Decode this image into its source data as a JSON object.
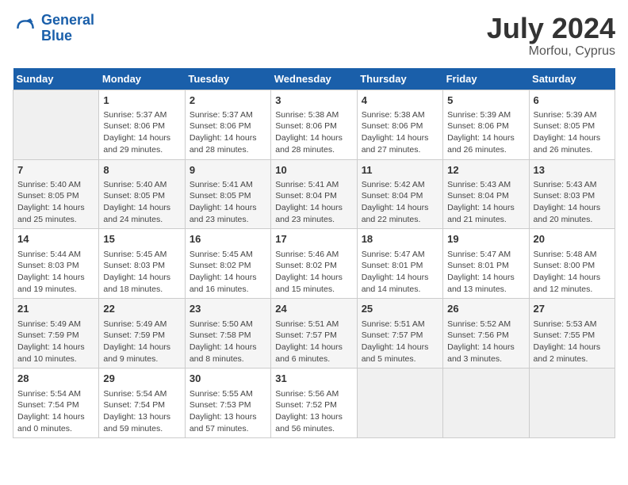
{
  "header": {
    "logo_line1": "General",
    "logo_line2": "Blue",
    "month_year": "July 2024",
    "location": "Morfou, Cyprus"
  },
  "weekdays": [
    "Sunday",
    "Monday",
    "Tuesday",
    "Wednesday",
    "Thursday",
    "Friday",
    "Saturday"
  ],
  "weeks": [
    [
      {
        "day": "",
        "content": ""
      },
      {
        "day": "1",
        "content": "Sunrise: 5:37 AM\nSunset: 8:06 PM\nDaylight: 14 hours\nand 29 minutes."
      },
      {
        "day": "2",
        "content": "Sunrise: 5:37 AM\nSunset: 8:06 PM\nDaylight: 14 hours\nand 28 minutes."
      },
      {
        "day": "3",
        "content": "Sunrise: 5:38 AM\nSunset: 8:06 PM\nDaylight: 14 hours\nand 28 minutes."
      },
      {
        "day": "4",
        "content": "Sunrise: 5:38 AM\nSunset: 8:06 PM\nDaylight: 14 hours\nand 27 minutes."
      },
      {
        "day": "5",
        "content": "Sunrise: 5:39 AM\nSunset: 8:06 PM\nDaylight: 14 hours\nand 26 minutes."
      },
      {
        "day": "6",
        "content": "Sunrise: 5:39 AM\nSunset: 8:05 PM\nDaylight: 14 hours\nand 26 minutes."
      }
    ],
    [
      {
        "day": "7",
        "content": "Sunrise: 5:40 AM\nSunset: 8:05 PM\nDaylight: 14 hours\nand 25 minutes."
      },
      {
        "day": "8",
        "content": "Sunrise: 5:40 AM\nSunset: 8:05 PM\nDaylight: 14 hours\nand 24 minutes."
      },
      {
        "day": "9",
        "content": "Sunrise: 5:41 AM\nSunset: 8:05 PM\nDaylight: 14 hours\nand 23 minutes."
      },
      {
        "day": "10",
        "content": "Sunrise: 5:41 AM\nSunset: 8:04 PM\nDaylight: 14 hours\nand 23 minutes."
      },
      {
        "day": "11",
        "content": "Sunrise: 5:42 AM\nSunset: 8:04 PM\nDaylight: 14 hours\nand 22 minutes."
      },
      {
        "day": "12",
        "content": "Sunrise: 5:43 AM\nSunset: 8:04 PM\nDaylight: 14 hours\nand 21 minutes."
      },
      {
        "day": "13",
        "content": "Sunrise: 5:43 AM\nSunset: 8:03 PM\nDaylight: 14 hours\nand 20 minutes."
      }
    ],
    [
      {
        "day": "14",
        "content": "Sunrise: 5:44 AM\nSunset: 8:03 PM\nDaylight: 14 hours\nand 19 minutes."
      },
      {
        "day": "15",
        "content": "Sunrise: 5:45 AM\nSunset: 8:03 PM\nDaylight: 14 hours\nand 18 minutes."
      },
      {
        "day": "16",
        "content": "Sunrise: 5:45 AM\nSunset: 8:02 PM\nDaylight: 14 hours\nand 16 minutes."
      },
      {
        "day": "17",
        "content": "Sunrise: 5:46 AM\nSunset: 8:02 PM\nDaylight: 14 hours\nand 15 minutes."
      },
      {
        "day": "18",
        "content": "Sunrise: 5:47 AM\nSunset: 8:01 PM\nDaylight: 14 hours\nand 14 minutes."
      },
      {
        "day": "19",
        "content": "Sunrise: 5:47 AM\nSunset: 8:01 PM\nDaylight: 14 hours\nand 13 minutes."
      },
      {
        "day": "20",
        "content": "Sunrise: 5:48 AM\nSunset: 8:00 PM\nDaylight: 14 hours\nand 12 minutes."
      }
    ],
    [
      {
        "day": "21",
        "content": "Sunrise: 5:49 AM\nSunset: 7:59 PM\nDaylight: 14 hours\nand 10 minutes."
      },
      {
        "day": "22",
        "content": "Sunrise: 5:49 AM\nSunset: 7:59 PM\nDaylight: 14 hours\nand 9 minutes."
      },
      {
        "day": "23",
        "content": "Sunrise: 5:50 AM\nSunset: 7:58 PM\nDaylight: 14 hours\nand 8 minutes."
      },
      {
        "day": "24",
        "content": "Sunrise: 5:51 AM\nSunset: 7:57 PM\nDaylight: 14 hours\nand 6 minutes."
      },
      {
        "day": "25",
        "content": "Sunrise: 5:51 AM\nSunset: 7:57 PM\nDaylight: 14 hours\nand 5 minutes."
      },
      {
        "day": "26",
        "content": "Sunrise: 5:52 AM\nSunset: 7:56 PM\nDaylight: 14 hours\nand 3 minutes."
      },
      {
        "day": "27",
        "content": "Sunrise: 5:53 AM\nSunset: 7:55 PM\nDaylight: 14 hours\nand 2 minutes."
      }
    ],
    [
      {
        "day": "28",
        "content": "Sunrise: 5:54 AM\nSunset: 7:54 PM\nDaylight: 14 hours\nand 0 minutes."
      },
      {
        "day": "29",
        "content": "Sunrise: 5:54 AM\nSunset: 7:54 PM\nDaylight: 13 hours\nand 59 minutes."
      },
      {
        "day": "30",
        "content": "Sunrise: 5:55 AM\nSunset: 7:53 PM\nDaylight: 13 hours\nand 57 minutes."
      },
      {
        "day": "31",
        "content": "Sunrise: 5:56 AM\nSunset: 7:52 PM\nDaylight: 13 hours\nand 56 minutes."
      },
      {
        "day": "",
        "content": ""
      },
      {
        "day": "",
        "content": ""
      },
      {
        "day": "",
        "content": ""
      }
    ]
  ]
}
